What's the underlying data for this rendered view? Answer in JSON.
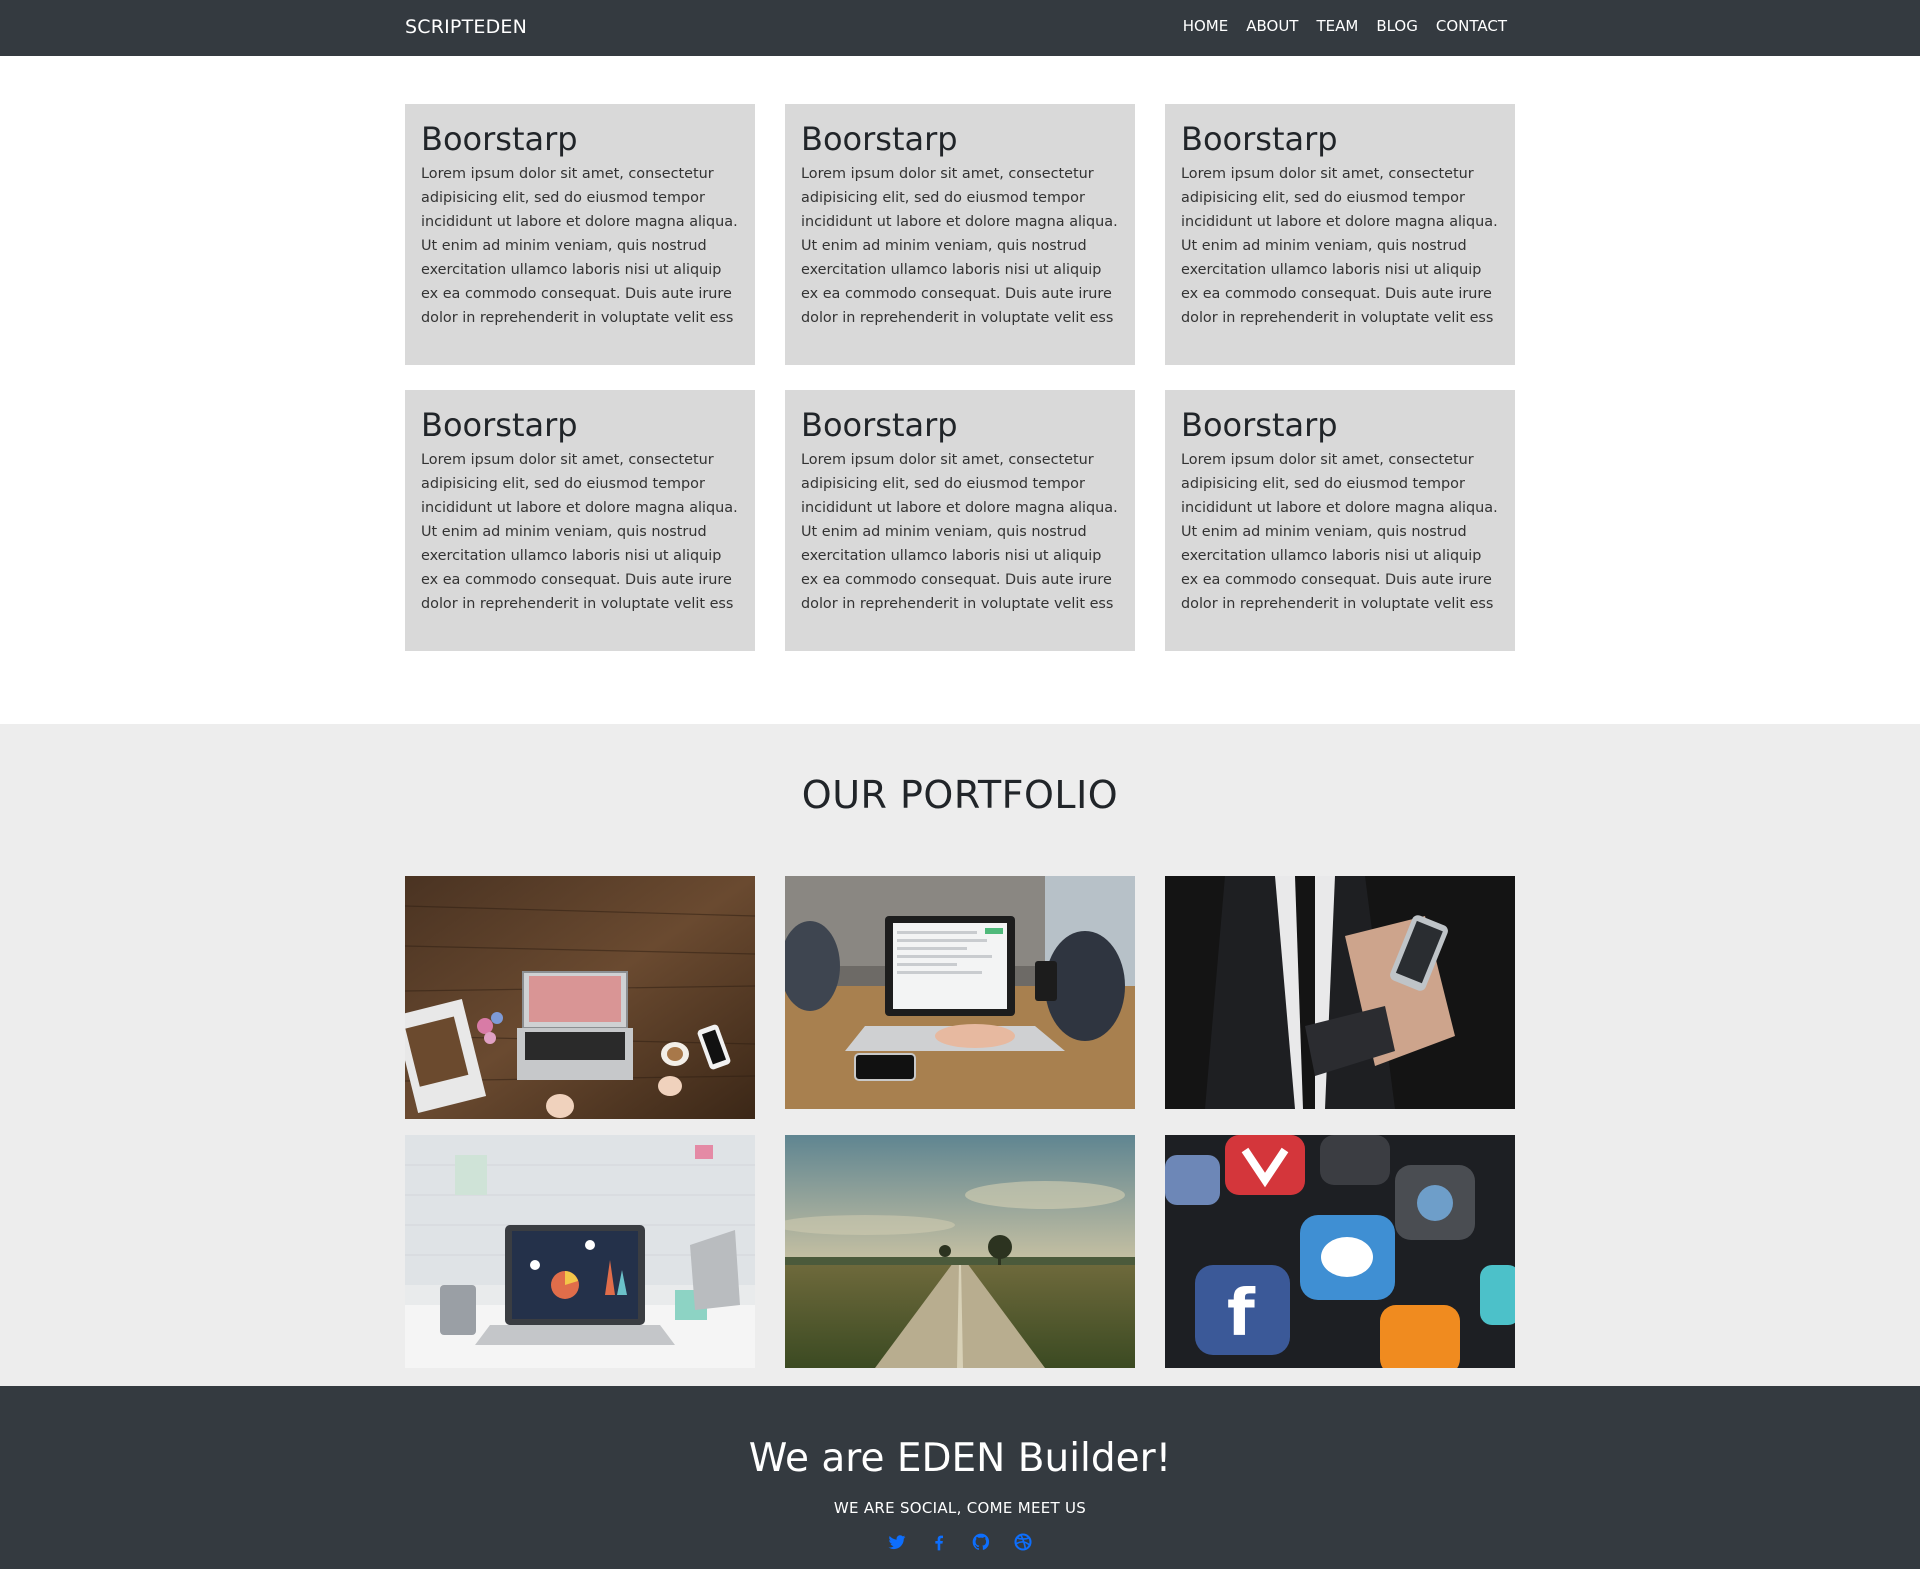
{
  "navbar": {
    "brand": "SCRIPTEDEN",
    "links": [
      "HOME",
      "ABOUT",
      "TEAM",
      "BLOG",
      "CONTACT"
    ]
  },
  "features": [
    {
      "title": "Boorstarp",
      "text": "Lorem ipsum dolor sit amet, consectetur adipisicing elit, sed do eiusmod tempor incididunt ut labore et dolore magna aliqua. Ut enim ad minim veniam, quis nostrud exercitation ullamco laboris nisi ut aliquip ex ea commodo consequat. Duis aute irure dolor in reprehenderit in voluptate velit ess"
    },
    {
      "title": "Boorstarp",
      "text": "Lorem ipsum dolor sit amet, consectetur adipisicing elit, sed do eiusmod tempor incididunt ut labore et dolore magna aliqua. Ut enim ad minim veniam, quis nostrud exercitation ullamco laboris nisi ut aliquip ex ea commodo consequat. Duis aute irure dolor in reprehenderit in voluptate velit ess"
    },
    {
      "title": "Boorstarp",
      "text": "Lorem ipsum dolor sit amet, consectetur adipisicing elit, sed do eiusmod tempor incididunt ut labore et dolore magna aliqua. Ut enim ad minim veniam, quis nostrud exercitation ullamco laboris nisi ut aliquip ex ea commodo consequat. Duis aute irure dolor in reprehenderit in voluptate velit ess"
    },
    {
      "title": "Boorstarp",
      "text": "Lorem ipsum dolor sit amet, consectetur adipisicing elit, sed do eiusmod tempor incididunt ut labore et dolore magna aliqua. Ut enim ad minim veniam, quis nostrud exercitation ullamco laboris nisi ut aliquip ex ea commodo consequat. Duis aute irure dolor in reprehenderit in voluptate velit ess"
    },
    {
      "title": "Boorstarp",
      "text": "Lorem ipsum dolor sit amet, consectetur adipisicing elit, sed do eiusmod tempor incididunt ut labore et dolore magna aliqua. Ut enim ad minim veniam, quis nostrud exercitation ullamco laboris nisi ut aliquip ex ea commodo consequat. Duis aute irure dolor in reprehenderit in voluptate velit ess"
    },
    {
      "title": "Boorstarp",
      "text": "Lorem ipsum dolor sit amet, consectetur adipisicing elit, sed do eiusmod tempor incididunt ut labore et dolore magna aliqua. Ut enim ad minim veniam, quis nostrud exercitation ullamco laboris nisi ut aliquip ex ea commodo consequat. Duis aute irure dolor in reprehenderit in voluptate velit ess"
    }
  ],
  "portfolio": {
    "title": "OUR PORTFOLIO",
    "images": [
      {
        "name": "laptop-on-wooden-desk-photo"
      },
      {
        "name": "team-meeting-laptop-photo"
      },
      {
        "name": "businessman-smartphone-photo"
      },
      {
        "name": "laptop-analytics-workspace-photo"
      },
      {
        "name": "countryside-road-photo"
      },
      {
        "name": "social-media-apps-photo"
      }
    ]
  },
  "footer": {
    "title": "We are EDEN Builder!",
    "subtitle": "WE ARE SOCIAL, COME MEET US",
    "social": [
      "twitter-icon",
      "facebook-icon",
      "github-icon",
      "dribbble-icon"
    ]
  },
  "colors": {
    "navbar_bg": "#343a40",
    "card_bg": "#d9d9d9",
    "portfolio_bg": "#ededed",
    "footer_bg": "#343a40",
    "social_icon": "#0d6efd"
  }
}
